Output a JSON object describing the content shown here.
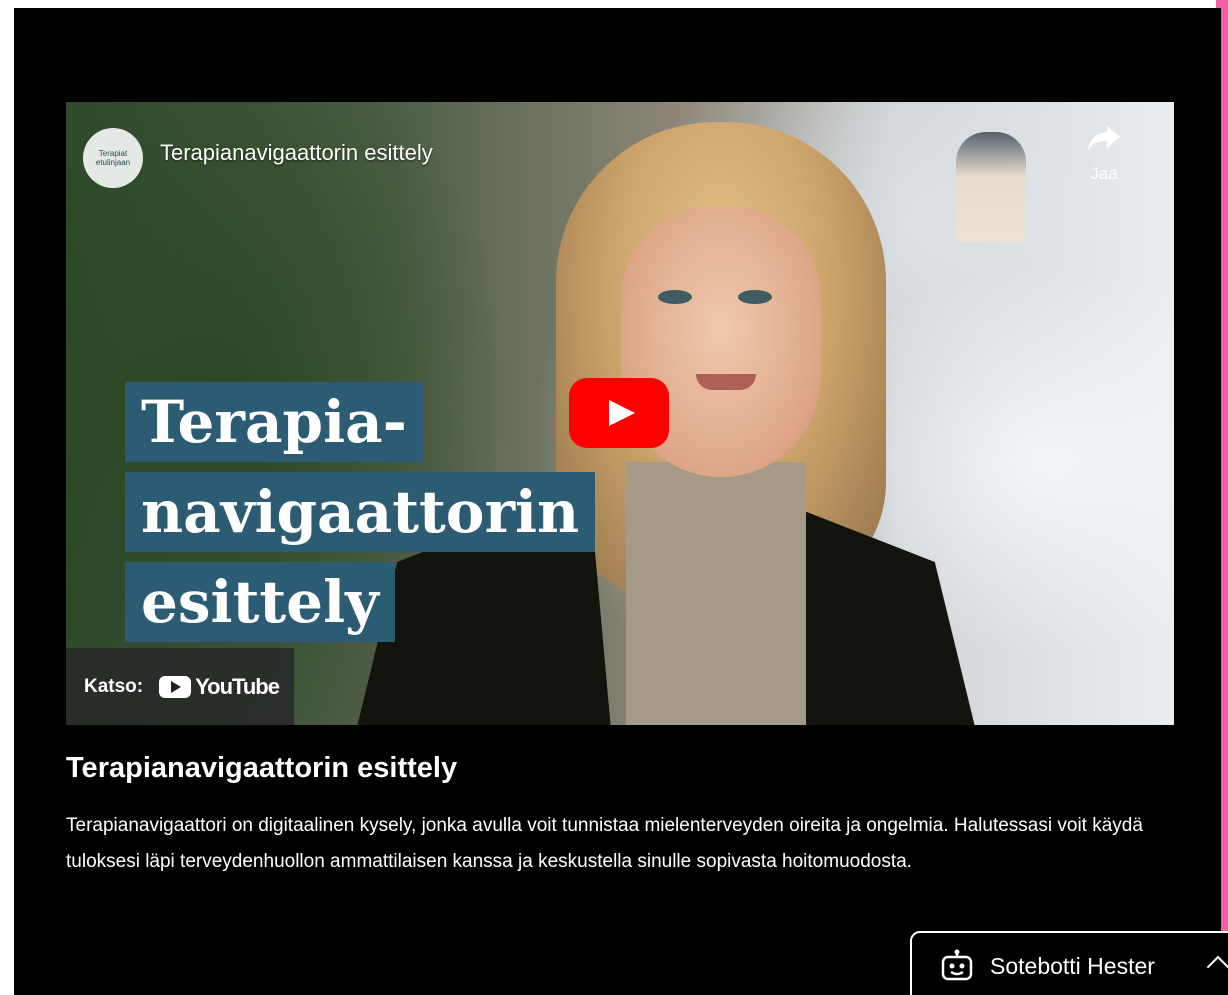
{
  "video": {
    "channel_avatar_text": "Terapiat etulinjaan",
    "title": "Terapianavigaattorin esittely",
    "share_label": "Jaa",
    "thumbnail_text": [
      "Terapia-",
      "navigaattorin",
      "esittely"
    ],
    "watch_on_label": "Katso:",
    "youtube_wordmark": "YouTube"
  },
  "content": {
    "title": "Terapianavigaattorin esittely",
    "description": "Terapianavigaattori on digitaalinen kysely, jonka avulla voit tunnistaa mielenterveyden oireita ja ongelmia. Halutessasi voit käydä tuloksesi läpi terveydenhuollon ammattilaisen kanssa ja keskustella sinulle sopivasta hoitomuodosta."
  },
  "chatbot": {
    "label": "Sotebotti Hester",
    "icon": "robot-icon"
  },
  "colors": {
    "page_background": "#000000",
    "title_banner": "#2b5c73",
    "play_button": "#ff0000",
    "accent_strip": "#f25ea8"
  }
}
